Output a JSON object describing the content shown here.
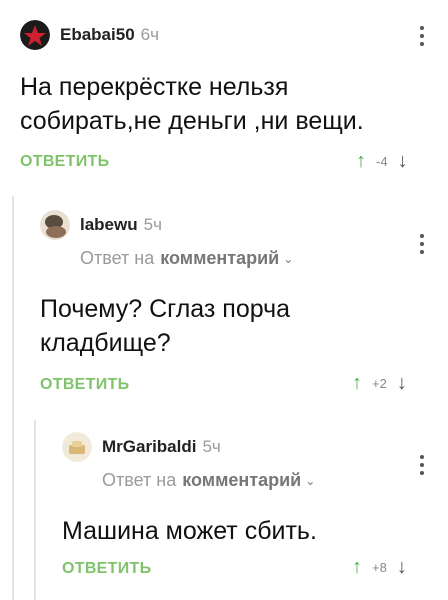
{
  "comments": [
    {
      "username": "Ebabai50",
      "time": "6ч",
      "text": "На перекрёстке нельзя собирать,не деньги ,ни вещи.",
      "reply_label": "ОТВЕТИТЬ",
      "rating": "-4"
    },
    {
      "username": "labewu",
      "time": "5ч",
      "reply_prefix": "Ответ на",
      "reply_link": "комментарий",
      "text": "Почему? Сглаз порча кладбище?",
      "reply_label": "ОТВЕТИТЬ",
      "rating": "+2"
    },
    {
      "username": "MrGaribaldi",
      "time": "5ч",
      "reply_prefix": "Ответ на",
      "reply_link": "комментарий",
      "text": "Машина может сбить.",
      "reply_label": "ОТВЕТИТЬ",
      "rating": "+8"
    }
  ],
  "colors": {
    "reply_green": "#7fc36b",
    "upvote_green": "#4caf50",
    "muted_gray": "#9a9a9a"
  }
}
